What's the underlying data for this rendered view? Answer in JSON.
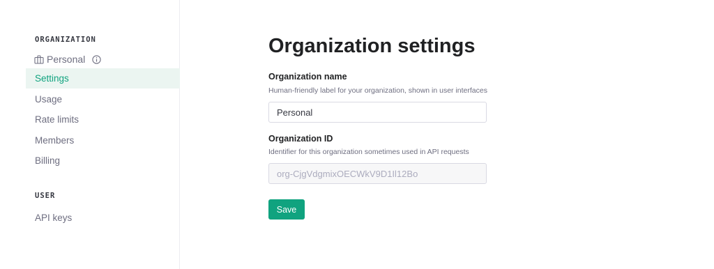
{
  "sidebar": {
    "organization_heading": "ORGANIZATION",
    "org_switcher": {
      "label": "Personal",
      "icon": "briefcase-icon",
      "info_icon": "info-icon"
    },
    "org_items": [
      {
        "label": "Settings",
        "active": true
      },
      {
        "label": "Usage",
        "active": false
      },
      {
        "label": "Rate limits",
        "active": false
      },
      {
        "label": "Members",
        "active": false
      },
      {
        "label": "Billing",
        "active": false
      }
    ],
    "user_heading": "USER",
    "user_items": [
      {
        "label": "API keys",
        "active": false
      }
    ]
  },
  "main": {
    "title": "Organization settings",
    "org_name": {
      "label": "Organization name",
      "help": "Human-friendly label for your organization, shown in user interfaces",
      "value": "Personal"
    },
    "org_id": {
      "label": "Organization ID",
      "help": "Identifier for this organization sometimes used in API requests",
      "value": "org-CjgVdgmixOECWkV9D1Il12Bo"
    },
    "save_label": "Save"
  },
  "colors": {
    "accent": "#10a37f",
    "active_bg": "#ebf5f1",
    "text_primary": "#202123",
    "text_secondary": "#6e6e80",
    "border": "#d9d9e3"
  }
}
